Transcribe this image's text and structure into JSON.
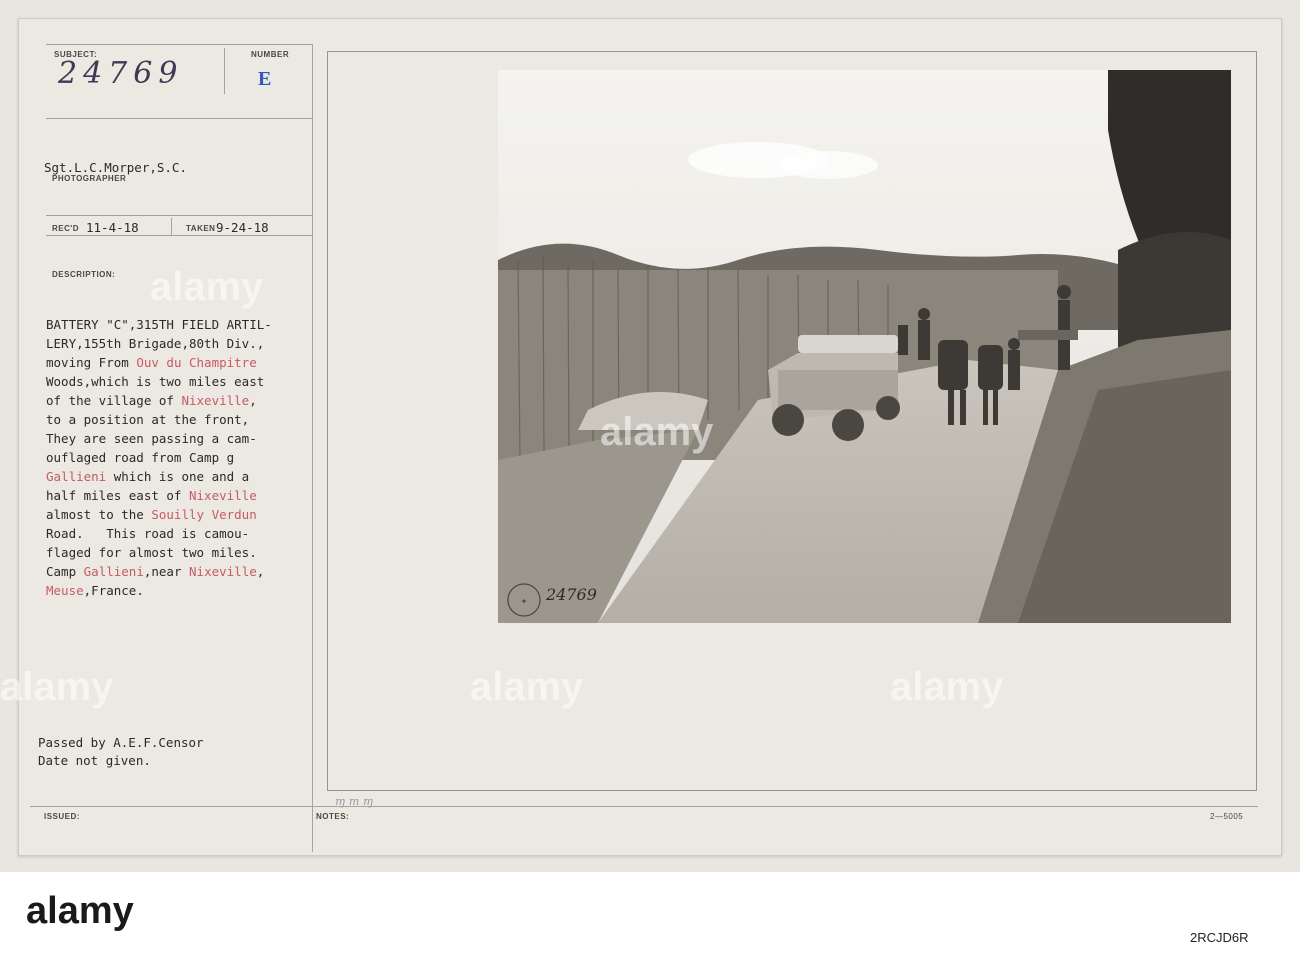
{
  "card": {
    "subject_label": "SUBJECT:",
    "subject_value": "24769",
    "number_label": "NUMBER",
    "number_value": "E",
    "photographer_name": "Sgt.L.C.Morper,S.C.",
    "photographer_label": "PHOTOGRAPHER",
    "recd_label": "REC'D",
    "recd_value": "11-4-18",
    "taken_label": "TAKEN",
    "taken_value": "9-24-18",
    "description_label": "DESCRIPTION:",
    "description_lines": [
      "BATTERY \"C\",315TH FIELD ARTIL-",
      "LERY,155th Brigade,80th Div.,",
      "moving From Ouv du Champitre",
      "Woods,which is two miles east",
      "of the village of Nixeville,",
      "to a position at the front,",
      "They are seen passing a cam-",
      "ouflaged road from Camp g",
      "Gallieni which is one and a",
      "half miles east of Nixeville",
      "almost to the Souilly Verdun",
      "Road.   This road is camou-",
      "flaged for almost two miles.",
      "Camp Gallieni,near Nixeville,",
      "Meuse,France."
    ],
    "censor_line1": "Passed by A.E.F.Censor",
    "censor_line2": "Date not given.",
    "issued_label": "ISSUED:",
    "notes_label": "NOTES:",
    "form_number": "2—5005",
    "photo_stamp_text": "SIGNAL CORPS USA",
    "photo_number": "24769"
  },
  "watermarks": [
    "alamy",
    "alamy",
    "alamy",
    "alamy",
    "alamy"
  ],
  "band": {
    "logo": "alamy",
    "image_id": "2RCJD6R"
  },
  "colors": {
    "card": "#ece8e2",
    "ink": "#2c2a28",
    "red_ink": "#c85a66",
    "blue_stamp": "#2f58c0"
  }
}
